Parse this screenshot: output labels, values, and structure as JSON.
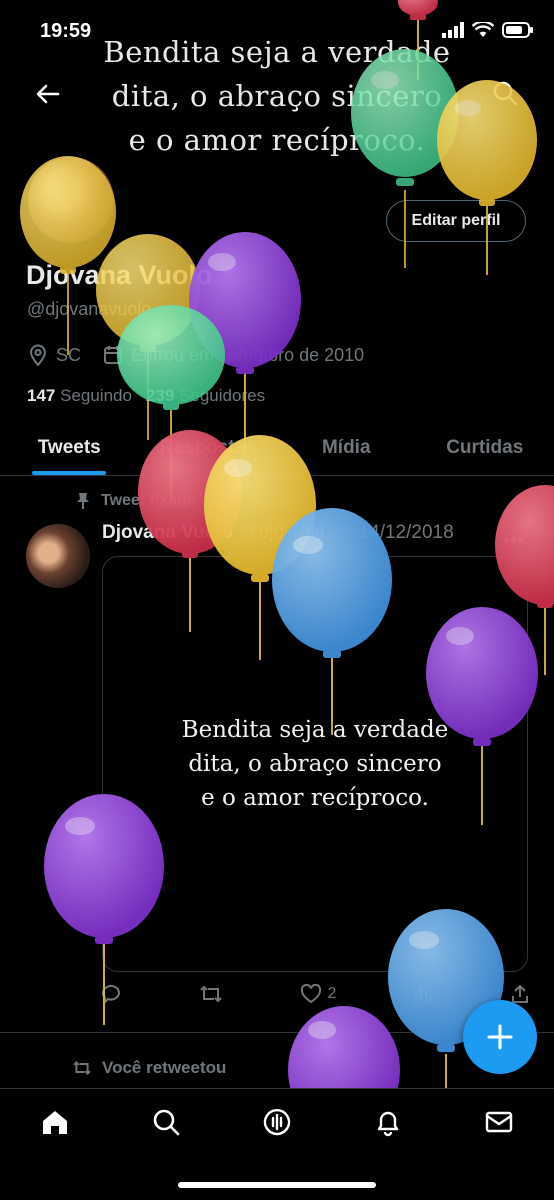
{
  "status_bar": {
    "time": "19:59"
  },
  "banner": {
    "lines": [
      "Bendita seja a verdade",
      "dita, o abraço sincero",
      "e o amor recíproco."
    ]
  },
  "profile": {
    "edit_label": "Editar perfil",
    "name": "Djovana Vuolo",
    "handle": "@djovanavuolo",
    "location": "SC",
    "joined": "Entrou em setembro de 2010",
    "following_count": "147",
    "following_label": "Seguindo",
    "followers_count": "239",
    "followers_label": "Seguidores"
  },
  "tabs": [
    {
      "label": "Tweets",
      "active": true
    },
    {
      "label": "Respostas",
      "active": false
    },
    {
      "label": "Mídia",
      "active": false
    },
    {
      "label": "Curtidas",
      "active": false
    }
  ],
  "pinned_tweet": {
    "pinned_label": "Tweet fixado",
    "author_name": "Djovana Vuolo",
    "author_handle": "@djovana...",
    "date": "· 14/12/2018",
    "media_lines": [
      "Bendita seja a verdade",
      "dita, o abraço sincero",
      "e o amor recíproco."
    ],
    "like_count": "2"
  },
  "retweet": {
    "label": "Você retweetou"
  },
  "colors": {
    "accent": "#1d9bf0",
    "background": "#000000",
    "muted": "#71767b"
  },
  "icons": [
    "back-icon",
    "search-icon",
    "location-icon",
    "calendar-icon",
    "pin-icon",
    "reply-icon",
    "retweet-icon",
    "like-icon",
    "views-icon",
    "share-icon",
    "compose-icon",
    "home-icon",
    "spaces-icon",
    "bell-icon",
    "mail-icon"
  ]
}
